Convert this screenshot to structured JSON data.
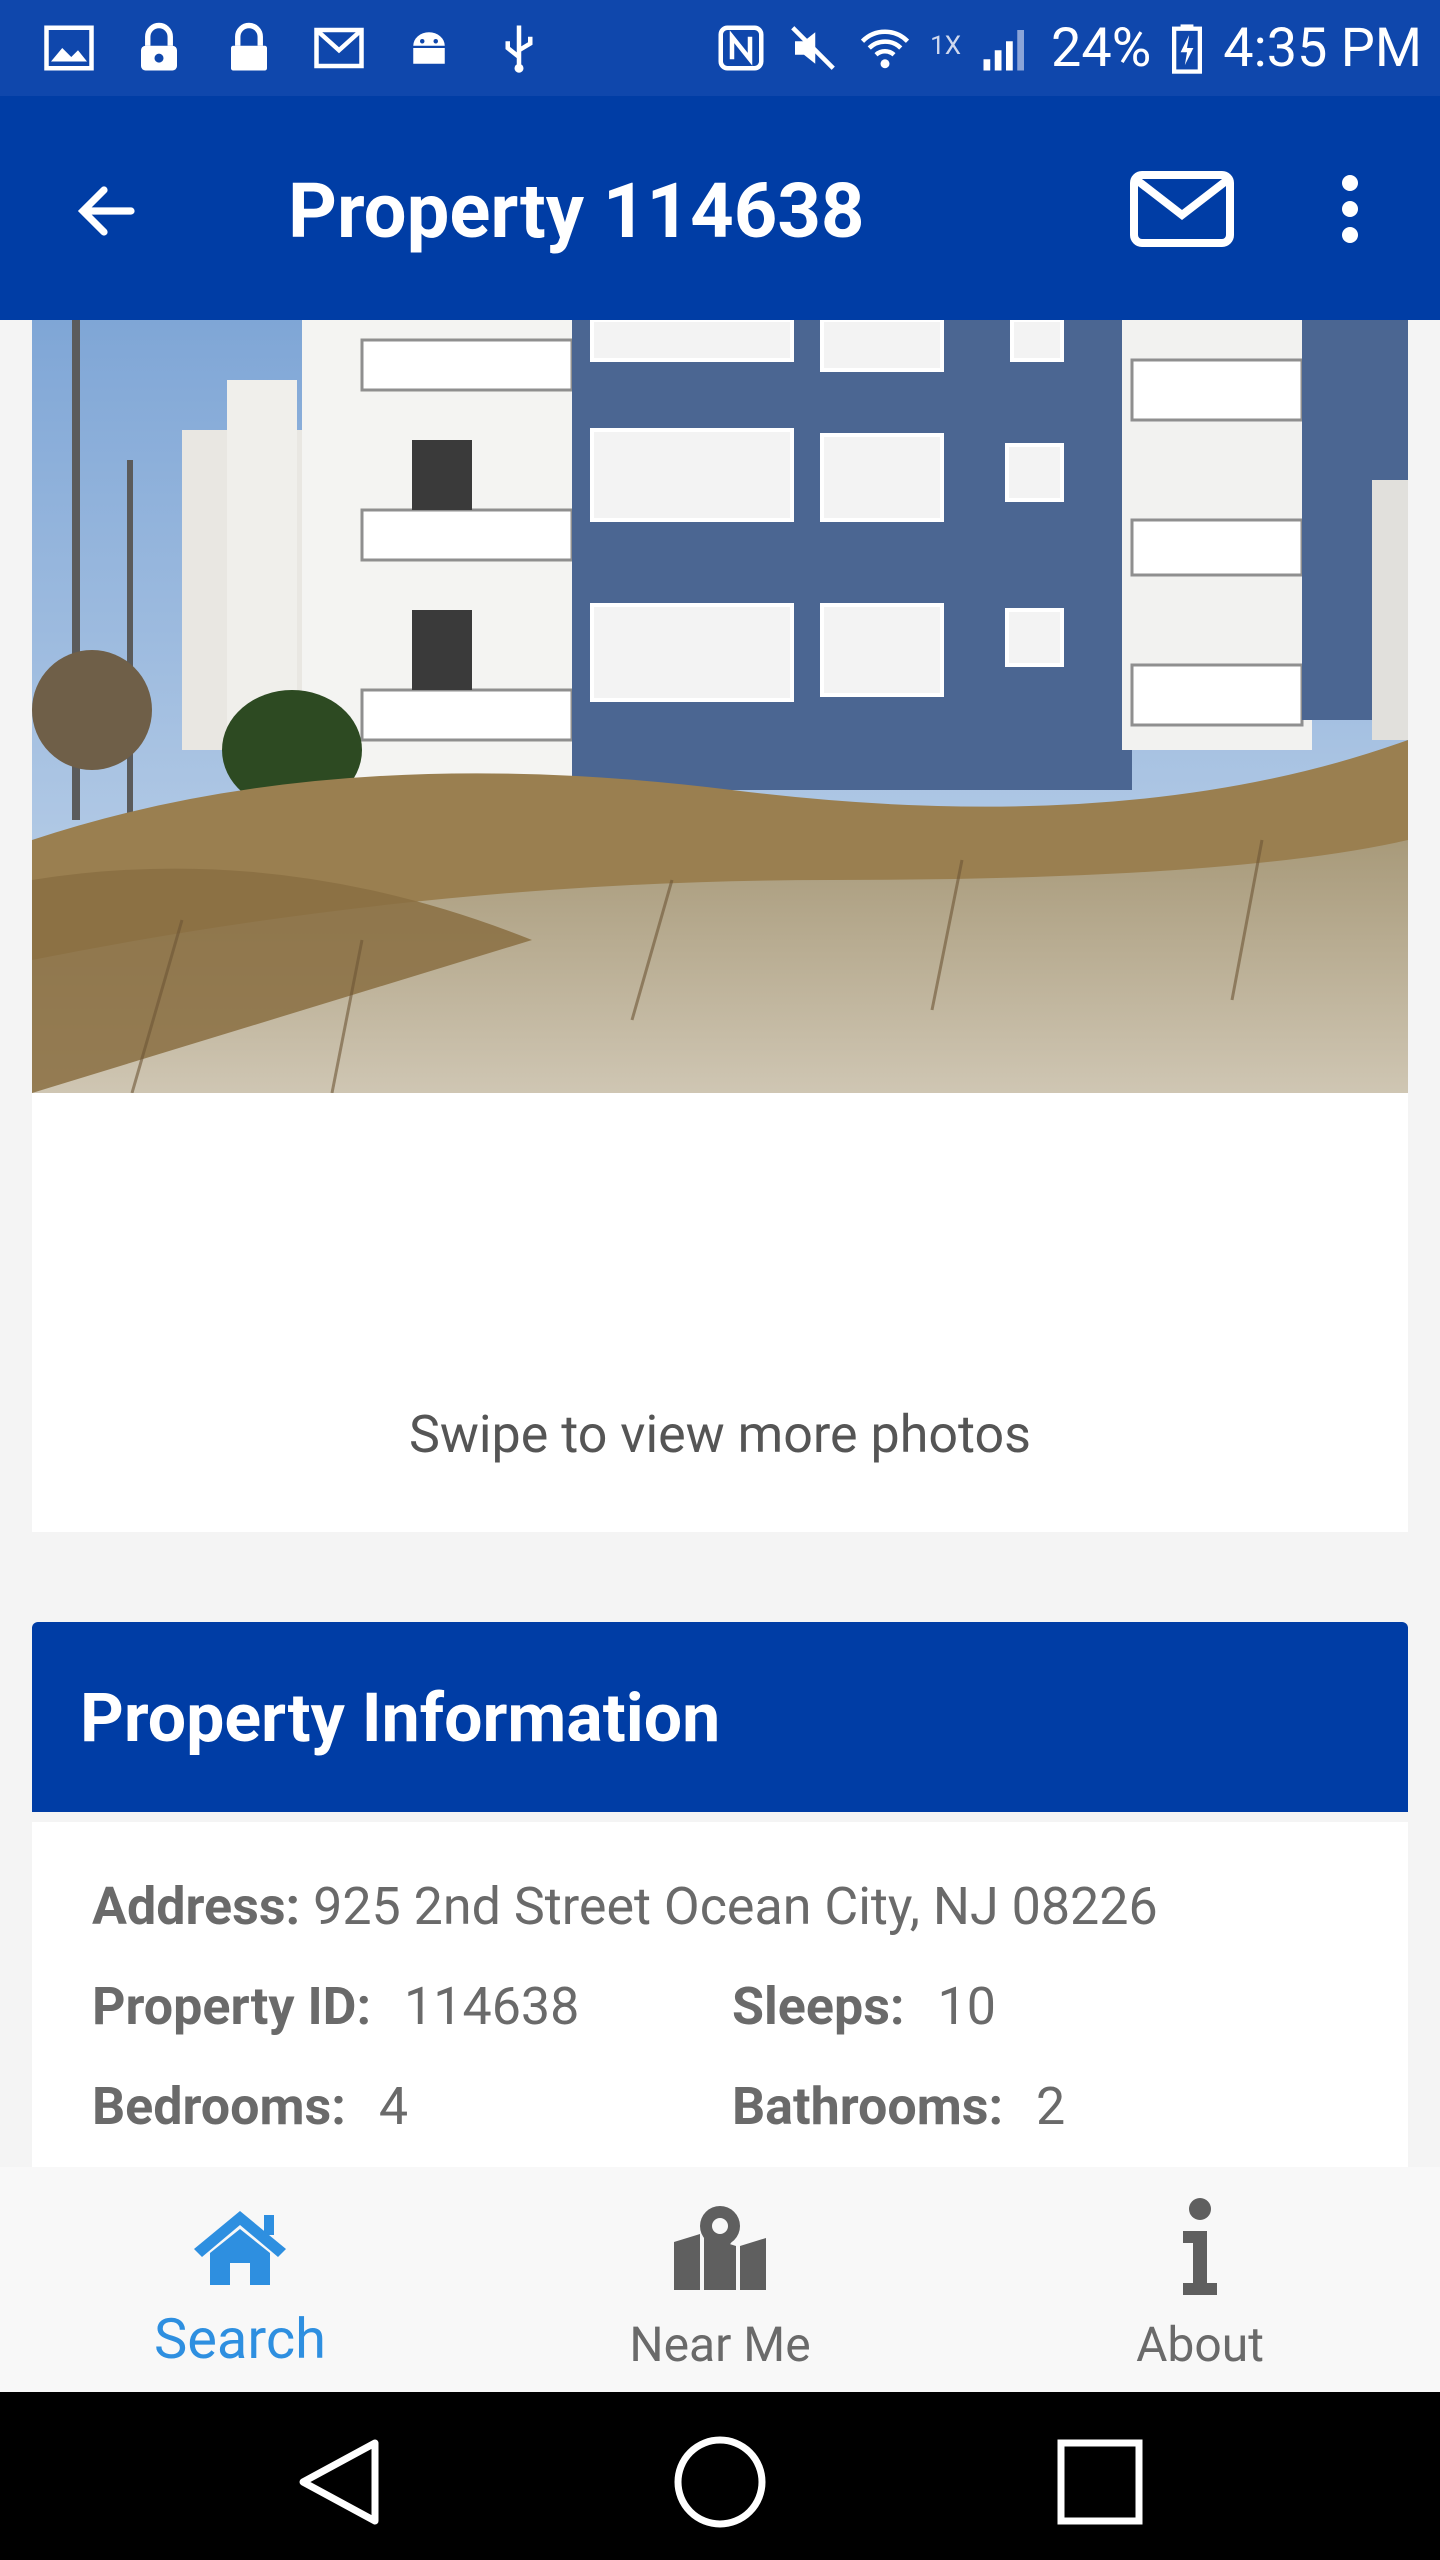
{
  "status_bar": {
    "signal_label": "1X",
    "battery": "24%",
    "time": "4:35 PM",
    "icons": [
      "gallery-icon",
      "lock-icon",
      "lock-icon",
      "gmail-icon",
      "android-icon",
      "usb-icon",
      "nfc-icon",
      "mute-icon",
      "wifi-icon",
      "signal-icon",
      "battery-charging-icon"
    ]
  },
  "app_bar": {
    "title": "Property 114638",
    "icons": [
      "back-arrow-icon",
      "mail-icon",
      "more-vert-icon"
    ]
  },
  "photo": {
    "swipe_hint": "Swipe to view more photos"
  },
  "property_info": {
    "header": "Property Information",
    "address_label": "Address:",
    "address_value": "925 2nd Street Ocean City, NJ 08226",
    "property_id_label": "Property ID:",
    "property_id_value": "114638",
    "sleeps_label": "Sleeps:",
    "sleeps_value": "10",
    "bedrooms_label": "Bedrooms:",
    "bedrooms_value": "4",
    "bathrooms_label": "Bathrooms:",
    "bathrooms_value": "2"
  },
  "bottom_nav": {
    "items": [
      {
        "label": "Search",
        "icon": "home-icon",
        "active": true
      },
      {
        "label": "Near Me",
        "icon": "map-pin-icon",
        "active": false
      },
      {
        "label": "About",
        "icon": "info-icon",
        "active": false
      }
    ]
  },
  "system_nav": {
    "icons": [
      "back-triangle-icon",
      "home-circle-icon",
      "recents-square-icon"
    ]
  },
  "colors": {
    "app_bar": "#003da5",
    "status_bar": "#0f47ac",
    "active_nav": "#2e8fe0",
    "text_gray": "#6a6a6a"
  }
}
